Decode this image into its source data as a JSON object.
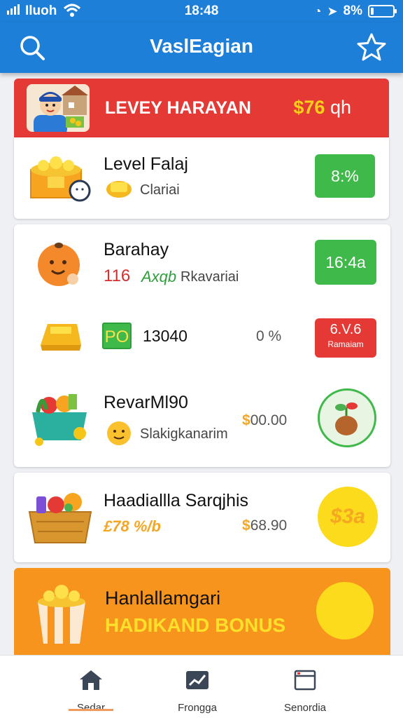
{
  "status": {
    "carrier": "Iluoh",
    "time": "18:48",
    "battery": "8%"
  },
  "appbar": {
    "title": "VaslEagian",
    "search_icon": "search-icon",
    "star_icon": "star-icon"
  },
  "hero": {
    "title": "LEVEY HARAYAN",
    "amount_symbol": "$",
    "amount_value": "76",
    "amount_unit": "qh"
  },
  "items": [
    {
      "name": "Level Falaj",
      "sub": "Clariai",
      "badge": "8:%"
    },
    {
      "name": "Barahay",
      "num": "116",
      "code": "Axqb",
      "sub": "Rkavariai",
      "badge": "16:4a"
    },
    {
      "tag": "PO",
      "value": "13040",
      "pct": "0 %",
      "badge_top": "6.V.6",
      "badge_bottom": "Ramaiam"
    },
    {
      "name": "RevarMl90",
      "sub": "Slakigkanarim",
      "price_symbol": "$",
      "price_value": "00.00"
    },
    {
      "name": "Haadiallla Sarqjhis",
      "sub": "£78 %/b",
      "price_symbol": "$",
      "price_value": "68.90",
      "coin_label": "$3a"
    }
  ],
  "bonus": {
    "title": "Hanlallamgari",
    "label": "HADIKAND BONUS"
  },
  "nav": [
    {
      "label": "Sedar",
      "icon": "home-icon"
    },
    {
      "label": "Frongga",
      "icon": "chart-icon"
    },
    {
      "label": "Senordia",
      "icon": "window-icon"
    }
  ],
  "colors": {
    "primary": "#1e7fd8",
    "hero": "#e53935",
    "accent_green": "#3fb94a",
    "bonus": "#f7941d",
    "gold": "#f7d117"
  }
}
